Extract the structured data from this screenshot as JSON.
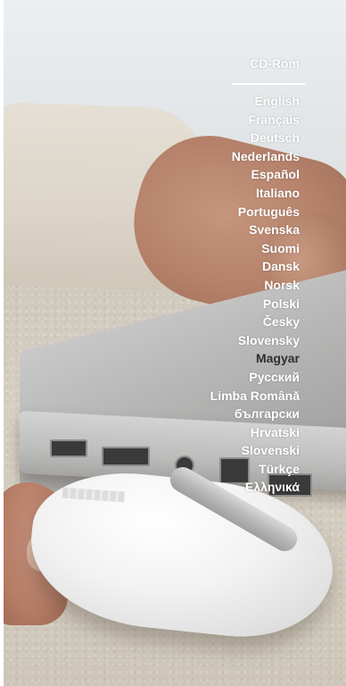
{
  "menu": {
    "title": "CD-Rom",
    "languages": [
      "English",
      "Français",
      "Deutsch",
      "Nederlands",
      "Español",
      "Italiano",
      "Português",
      "Svenska",
      "Suomi",
      "Dansk",
      "Norsk",
      "Polski",
      "Česky",
      "Slovensky",
      "Magyar",
      "Русский",
      "Limba Română",
      "български",
      "Hrvatski",
      "Slovenski",
      "Türkçe",
      "Ελληνικά"
    ],
    "active_language": "Magyar"
  },
  "colors": {
    "menu_text": "#ffffff",
    "menu_text_active": "#2f2f2f"
  }
}
